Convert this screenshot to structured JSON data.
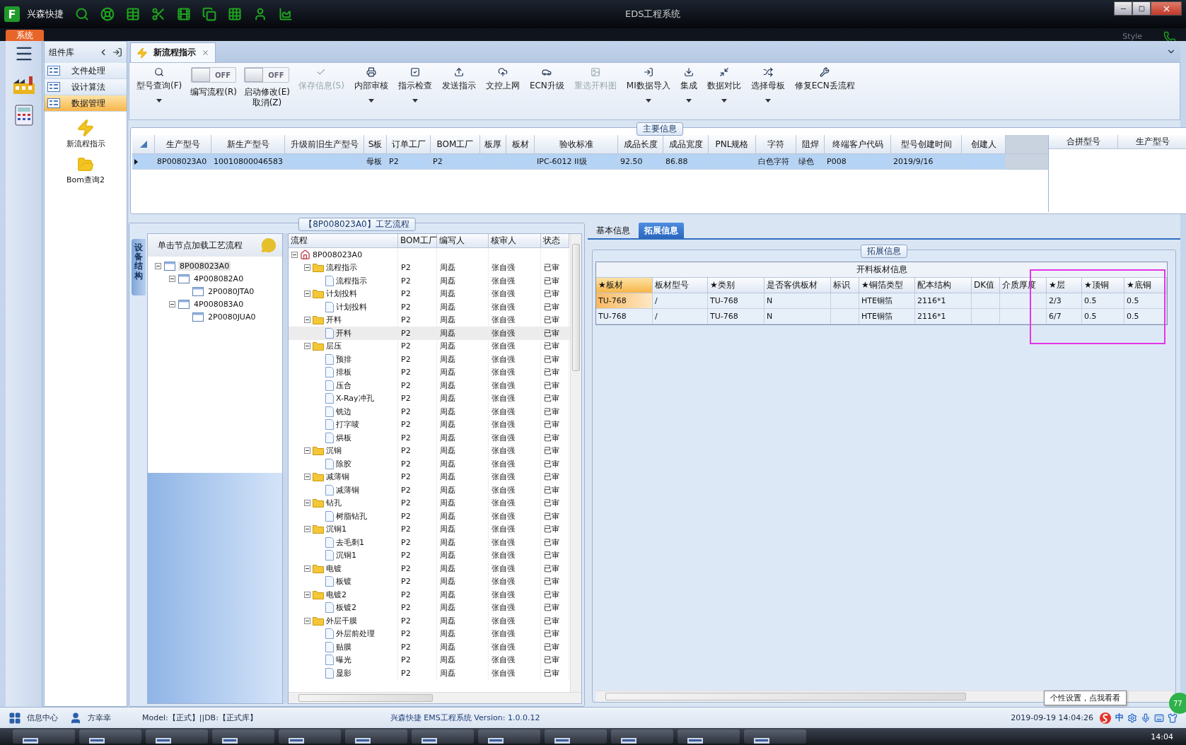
{
  "title_bar": {
    "logo": "F",
    "app_name": "兴森快捷",
    "title": "EDS工程系统",
    "style_label": "Style"
  },
  "ribbon_tabs": [
    {
      "label": "系统",
      "selected": true
    }
  ],
  "component_library": {
    "title": "组件库",
    "items": [
      {
        "label": "文件处理",
        "selected": false
      },
      {
        "label": "设计算法",
        "selected": false
      },
      {
        "label": "数据管理",
        "selected": true
      }
    ],
    "tools": [
      {
        "label": "新流程指示"
      },
      {
        "label": "Bom查询2"
      }
    ]
  },
  "document_tabs": [
    {
      "label": "新流程指示",
      "selected": true
    }
  ],
  "toolbar": [
    {
      "kind": "button",
      "lines": [
        "型号查询(F)"
      ],
      "disabled": false,
      "dropdown": true
    },
    {
      "kind": "toggle",
      "lines": [
        "编写流程(R)"
      ],
      "on": false,
      "state_text": "OFF"
    },
    {
      "kind": "toggle",
      "lines": [
        "启动修改(E)",
        "取消(Z)"
      ],
      "on": false,
      "state_text": "OFF"
    },
    {
      "kind": "button",
      "lines": [
        "保存信息(S)"
      ],
      "disabled": true,
      "dropdown": false
    },
    {
      "kind": "button",
      "lines": [
        "内部审核"
      ],
      "disabled": false,
      "dropdown": true
    },
    {
      "kind": "button",
      "lines": [
        "指示检查"
      ],
      "disabled": false,
      "dropdown": true
    },
    {
      "kind": "button",
      "lines": [
        "发送指示"
      ],
      "disabled": false,
      "dropdown": false
    },
    {
      "kind": "button",
      "lines": [
        "文控上网"
      ],
      "disabled": false,
      "dropdown": false
    },
    {
      "kind": "button",
      "lines": [
        "ECN升级"
      ],
      "disabled": false,
      "dropdown": false
    },
    {
      "kind": "button",
      "lines": [
        "重选开料图"
      ],
      "disabled": true,
      "dropdown": false
    },
    {
      "kind": "button",
      "lines": [
        "MI数据导入"
      ],
      "disabled": false,
      "dropdown": true
    },
    {
      "kind": "button",
      "lines": [
        "集成"
      ],
      "disabled": false,
      "dropdown": true
    },
    {
      "kind": "button",
      "lines": [
        "数据对比"
      ],
      "disabled": false,
      "dropdown": true
    },
    {
      "kind": "button",
      "lines": [
        "选择母板"
      ],
      "disabled": false,
      "dropdown": true
    },
    {
      "kind": "button",
      "lines": [
        "修复ECN丢流程"
      ],
      "disabled": false,
      "dropdown": false
    }
  ],
  "main_info": {
    "title": "主要信息",
    "columns": [
      "生产型号",
      "新生产型号",
      "升级前旧生产型号",
      "S板",
      "订单工厂",
      "BOM工厂",
      "板厚",
      "板材",
      "验收标准",
      "成品长度",
      "成品宽度",
      "PNL规格",
      "字符",
      "阻焊",
      "终端客户代码",
      "型号创建时间",
      "创建人"
    ],
    "rows": [
      {
        "selected": true,
        "cells": [
          "8P008023A0",
          "10010800046583",
          null,
          "母板",
          "P2",
          "P2",
          null,
          null,
          "IPC-6012 II级",
          "92.50",
          "86.88",
          null,
          "白色字符",
          "绿色",
          "P008",
          "2019/9/16",
          null
        ]
      }
    ],
    "side_columns": [
      "合拼型号",
      "生产型号"
    ]
  },
  "process_panel": {
    "title": "【8P008023A0】工艺流程",
    "side_tab": "设备结构",
    "hint": "单击节点加载工艺流程",
    "structure_tree": [
      {
        "label": "8P008023A0",
        "selected": true,
        "expanded": true,
        "children": [
          {
            "label": "4P008082A0",
            "selected": false,
            "expanded": true,
            "children": [
              {
                "label": "2P0080JTA0",
                "selected": false
              }
            ]
          },
          {
            "label": "4P008083A0",
            "selected": false,
            "expanded": true,
            "children": [
              {
                "label": "2P0080JUA0",
                "selected": false
              }
            ]
          }
        ]
      }
    ],
    "flow_columns": [
      "流程",
      "BOM工厂",
      "编写人",
      "核审人",
      "状态"
    ],
    "flow_tree": [
      {
        "label": "8P008023A0",
        "kind": "root",
        "selected": false,
        "expanded": true,
        "children": [
          {
            "label": "流程指示",
            "kind": "folder",
            "selected": false,
            "expanded": true,
            "bom_factory": "P2",
            "writer": "周磊",
            "reviewer": "张自强",
            "status": "已审",
            "children": [
              {
                "label": "流程指示",
                "kind": "document",
                "selected": false,
                "bom_factory": "P2",
                "writer": "周磊",
                "reviewer": "张自强",
                "status": "已审"
              }
            ]
          },
          {
            "label": "计划投料",
            "kind": "folder",
            "selected": false,
            "expanded": true,
            "bom_factory": "P2",
            "writer": "周磊",
            "reviewer": "张自强",
            "status": "已审",
            "children": [
              {
                "label": "计划投料",
                "kind": "document",
                "selected": false,
                "bom_factory": "P2",
                "writer": "周磊",
                "reviewer": "张自强",
                "status": "已审"
              }
            ]
          },
          {
            "label": "开料",
            "kind": "folder",
            "selected": false,
            "expanded": true,
            "bom_factory": "P2",
            "writer": "周磊",
            "reviewer": "张自强",
            "status": "已审",
            "children": [
              {
                "label": "开料",
                "kind": "document",
                "selected": true,
                "bom_factory": "P2",
                "writer": "周磊",
                "reviewer": "张自强",
                "status": "已审"
              }
            ]
          },
          {
            "label": "层压",
            "kind": "folder",
            "selected": false,
            "expanded": true,
            "bom_factory": "P2",
            "writer": "周磊",
            "reviewer": "张自强",
            "status": "已审",
            "children": [
              {
                "label": "预排",
                "kind": "document",
                "selected": false,
                "bom_factory": "P2",
                "writer": "周磊",
                "reviewer": "张自强",
                "status": "已审"
              },
              {
                "label": "排板",
                "kind": "document",
                "selected": false,
                "bom_factory": "P2",
                "writer": "周磊",
                "reviewer": "张自强",
                "status": "已审"
              },
              {
                "label": "压合",
                "kind": "document",
                "selected": false,
                "bom_factory": "P2",
                "writer": "周磊",
                "reviewer": "张自强",
                "status": "已审"
              },
              {
                "label": "X-Ray冲孔",
                "kind": "document",
                "selected": false,
                "bom_factory": "P2",
                "writer": "周磊",
                "reviewer": "张自强",
                "status": "已审"
              },
              {
                "label": "铣边",
                "kind": "document",
                "selected": false,
                "bom_factory": "P2",
                "writer": "周磊",
                "reviewer": "张自强",
                "status": "已审"
              },
              {
                "label": "打字唛",
                "kind": "document",
                "selected": false,
                "bom_factory": "P2",
                "writer": "周磊",
                "reviewer": "张自强",
                "status": "已审"
              },
              {
                "label": "烘板",
                "kind": "document",
                "selected": false,
                "bom_factory": "P2",
                "writer": "周磊",
                "reviewer": "张自强",
                "status": "已审"
              }
            ]
          },
          {
            "label": "沉铜",
            "kind": "folder",
            "selected": false,
            "expanded": true,
            "bom_factory": "P2",
            "writer": "周磊",
            "reviewer": "张自强",
            "status": "已审",
            "children": [
              {
                "label": "除胶",
                "kind": "document",
                "selected": false,
                "bom_factory": "P2",
                "writer": "周磊",
                "reviewer": "张自强",
                "status": "已审"
              }
            ]
          },
          {
            "label": "减薄铜",
            "kind": "folder",
            "selected": false,
            "expanded": true,
            "bom_factory": "P2",
            "writer": "周磊",
            "reviewer": "张自强",
            "status": "已审",
            "children": [
              {
                "label": "减薄铜",
                "kind": "document",
                "selected": false,
                "bom_factory": "P2",
                "writer": "周磊",
                "reviewer": "张自强",
                "status": "已审"
              }
            ]
          },
          {
            "label": "钻孔",
            "kind": "folder",
            "selected": false,
            "expanded": true,
            "bom_factory": "P2",
            "writer": "周磊",
            "reviewer": "张自强",
            "status": "已审",
            "children": [
              {
                "label": "树脂钻孔",
                "kind": "document",
                "selected": false,
                "bom_factory": "P2",
                "writer": "周磊",
                "reviewer": "张自强",
                "status": "已审"
              }
            ]
          },
          {
            "label": "沉铜1",
            "kind": "folder",
            "selected": false,
            "expanded": true,
            "bom_factory": "P2",
            "writer": "周磊",
            "reviewer": "张自强",
            "status": "已审",
            "children": [
              {
                "label": "去毛刺1",
                "kind": "document",
                "selected": false,
                "bom_factory": "P2",
                "writer": "周磊",
                "reviewer": "张自强",
                "status": "已审"
              },
              {
                "label": "沉铜1",
                "kind": "document",
                "selected": false,
                "bom_factory": "P2",
                "writer": "周磊",
                "reviewer": "张自强",
                "status": "已审"
              }
            ]
          },
          {
            "label": "电镀",
            "kind": "folder",
            "selected": false,
            "expanded": true,
            "bom_factory": "P2",
            "writer": "周磊",
            "reviewer": "张自强",
            "status": "已审",
            "children": [
              {
                "label": "板镀",
                "kind": "document",
                "selected": false,
                "bom_factory": "P2",
                "writer": "周磊",
                "reviewer": "张自强",
                "status": "已审"
              }
            ]
          },
          {
            "label": "电镀2",
            "kind": "folder",
            "selected": false,
            "expanded": true,
            "bom_factory": "P2",
            "writer": "周磊",
            "reviewer": "张自强",
            "status": "已审",
            "children": [
              {
                "label": "板镀2",
                "kind": "document",
                "selected": false,
                "bom_factory": "P2",
                "writer": "周磊",
                "reviewer": "张自强",
                "status": "已审"
              }
            ]
          },
          {
            "label": "外层干膜",
            "kind": "folder",
            "selected": false,
            "expanded": true,
            "bom_factory": "P2",
            "writer": "周磊",
            "reviewer": "张自强",
            "status": "已审",
            "children": [
              {
                "label": "外层前处理",
                "kind": "document",
                "selected": false,
                "bom_factory": "P2",
                "writer": "周磊",
                "reviewer": "张自强",
                "status": "已审"
              },
              {
                "label": "贴膜",
                "kind": "document",
                "selected": false,
                "bom_factory": "P2",
                "writer": "周磊",
                "reviewer": "张自强",
                "status": "已审"
              },
              {
                "label": "曝光",
                "kind": "document",
                "selected": false,
                "bom_factory": "P2",
                "writer": "周磊",
                "reviewer": "张自强",
                "status": "已审"
              },
              {
                "label": "显影",
                "kind": "document",
                "selected": false,
                "bom_factory": "P2",
                "writer": "周磊",
                "reviewer": "张自强",
                "status": "已审"
              }
            ]
          }
        ]
      }
    ]
  },
  "detail_panel": {
    "tabs": [
      {
        "label": "基本信息",
        "selected": false
      },
      {
        "label": "拓展信息",
        "selected": true
      }
    ],
    "group_title": "拓展信息",
    "table": {
      "caption": "开料板材信息",
      "columns": [
        {
          "label": "★板材",
          "active": true,
          "annotated": false
        },
        {
          "label": "板材型号",
          "active": false,
          "annotated": false
        },
        {
          "label": "★类别",
          "active": false,
          "annotated": false
        },
        {
          "label": "是否客供板材",
          "active": false,
          "annotated": false
        },
        {
          "label": "标识",
          "active": false,
          "annotated": false
        },
        {
          "label": "★铜箔类型",
          "active": false,
          "annotated": false
        },
        {
          "label": "配本结构",
          "active": false,
          "annotated": false
        },
        {
          "label": "DK值",
          "active": false,
          "annotated": false
        },
        {
          "label": "介质厚度",
          "active": false,
          "annotated": false
        },
        {
          "label": "★层",
          "active": false,
          "annotated": true
        },
        {
          "label": "★顶铜",
          "active": false,
          "annotated": true
        },
        {
          "label": "★底铜",
          "active": false,
          "annotated": true
        }
      ],
      "rows": [
        {
          "selected": true,
          "cells": [
            "TU-768",
            "/",
            "TU-768",
            "N",
            null,
            "HTE铜箔",
            "2116*1",
            null,
            null,
            "2/3",
            "0.5",
            "0.5"
          ]
        },
        {
          "selected": false,
          "cells": [
            "TU-768",
            "/",
            "TU-768",
            "N",
            null,
            "HTE铜箔",
            "2116*1",
            null,
            null,
            "6/7",
            "0.5",
            "0.5"
          ]
        }
      ]
    }
  },
  "status_bar": {
    "info_center": "信息中心",
    "user": "方幸幸",
    "db_info": "Model:【正式】||DB:【正式库】",
    "version": "兴森快捷 EMS工程系统 Version: 1.0.0.12",
    "datetime": "2019-09-19 14:04:26",
    "tooltip": "个性设置，点我看看",
    "ime": "中"
  },
  "taskbar": {
    "clock": "14:04"
  },
  "floating_badge": "77"
}
